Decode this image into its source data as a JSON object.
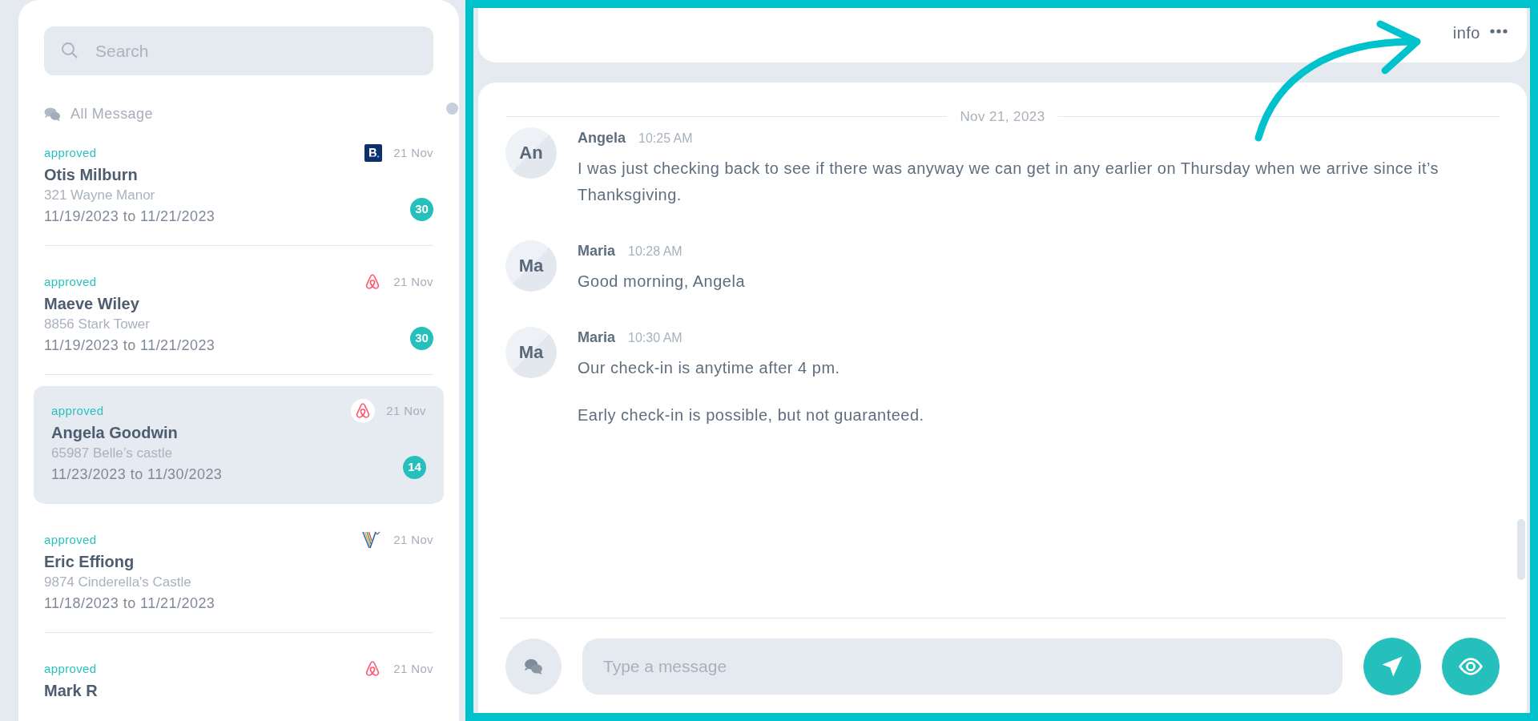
{
  "search": {
    "placeholder": "Search"
  },
  "list_heading": "All Message",
  "conversations": [
    {
      "status": "approved",
      "kind": "booking",
      "date": "21 Nov",
      "name": "Otis Milburn",
      "property": "321 Wayne Manor",
      "dates": "11/19/2023 to 11/21/2023",
      "unread": "30",
      "selected": false
    },
    {
      "status": "approved",
      "kind": "airbnb",
      "date": "21 Nov",
      "name": "Maeve Wiley",
      "property": "8856 Stark Tower",
      "dates": "11/19/2023 to 11/21/2023",
      "unread": "30",
      "selected": false
    },
    {
      "status": "approved",
      "kind": "airbnb",
      "date": "21 Nov",
      "name": "Angela Goodwin",
      "property": "65987 Belle’s castle",
      "dates": "11/23/2023 to 11/30/2023",
      "unread": "14",
      "selected": true
    },
    {
      "status": "approved",
      "kind": "vrbo",
      "date": "21 Nov",
      "name": "Eric Effiong",
      "property": "9874 Cinderella's Castle",
      "dates": "11/18/2023 to 11/21/2023",
      "selected": false
    },
    {
      "status": "approved",
      "kind": "airbnb",
      "date": "21 Nov",
      "name": "Mark R",
      "selected": false
    }
  ],
  "header": {
    "info": "info"
  },
  "date_divider": "Nov 21, 2023",
  "messages": [
    {
      "initials": "An",
      "sender": "Angela",
      "time": "10:25 AM",
      "paragraphs": [
        "I was just checking back to see if there was anyway we can get in any earlier on Thursday when we arrive since it’s Thanksgiving."
      ]
    },
    {
      "initials": "Ma",
      "sender": "Maria",
      "time": "10:28 AM",
      "paragraphs": [
        "Good morning, Angela"
      ]
    },
    {
      "initials": "Ma",
      "sender": "Maria",
      "time": "10:30 AM",
      "paragraphs": [
        "Our check-in is anytime after 4 pm.",
        "Early check-in is possible, but not guaranteed."
      ]
    }
  ],
  "composer": {
    "placeholder": "Type a message"
  }
}
